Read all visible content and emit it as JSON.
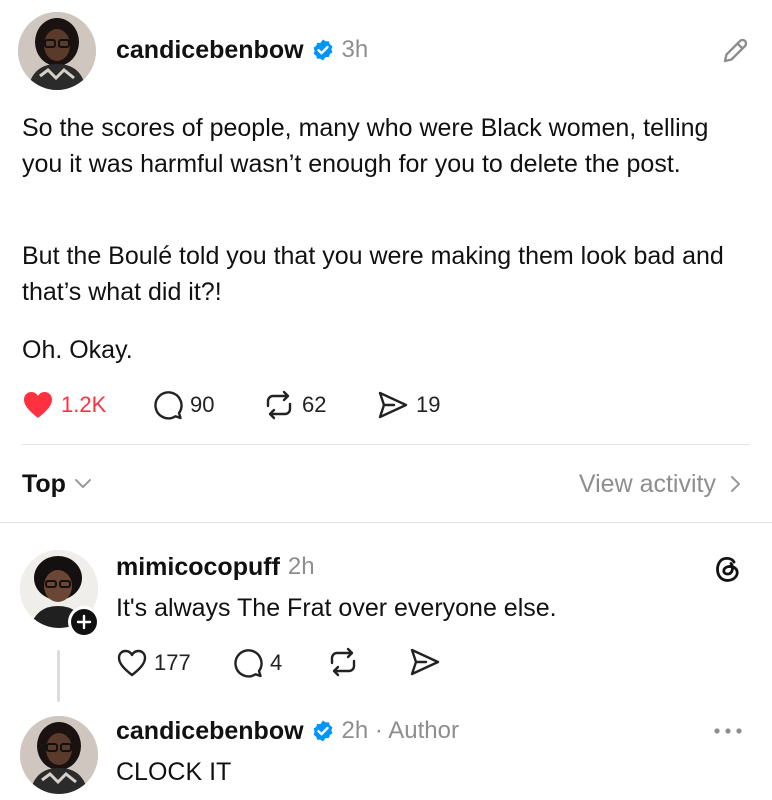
{
  "post": {
    "author": "candicebenbow",
    "time": "3h",
    "paragraphs": [
      "So the scores of people, many who were Black women, telling you it was harmful wasn’t enough for you to delete the post.",
      "But the Boulé told you that you were making them look bad and that’s what did it?!",
      "Oh. Okay."
    ],
    "actions": {
      "likes": "1.2K",
      "replies": "90",
      "reposts": "62",
      "shares": "19"
    }
  },
  "sort": {
    "label": "Top",
    "view_activity": "View activity"
  },
  "replies": [
    {
      "author": "mimicocopuff",
      "time": "2h",
      "text": "It's always The Frat over everyone else.",
      "likes": "177",
      "replies": "4"
    },
    {
      "author": "candicebenbow",
      "time": "2h · Author",
      "text": "CLOCK IT"
    }
  ],
  "colors": {
    "like_red": "#ff3040",
    "verified_blue": "#0095f6",
    "muted": "#8e8e8e"
  },
  "icons": [
    "edit-icon",
    "verified-badge-icon",
    "heart-filled-icon",
    "comment-icon",
    "repost-icon",
    "share-icon",
    "chevron-down-icon",
    "chevron-right-icon",
    "threads-logo-icon",
    "follow-plus-icon",
    "heart-outline-icon",
    "more-icon"
  ]
}
